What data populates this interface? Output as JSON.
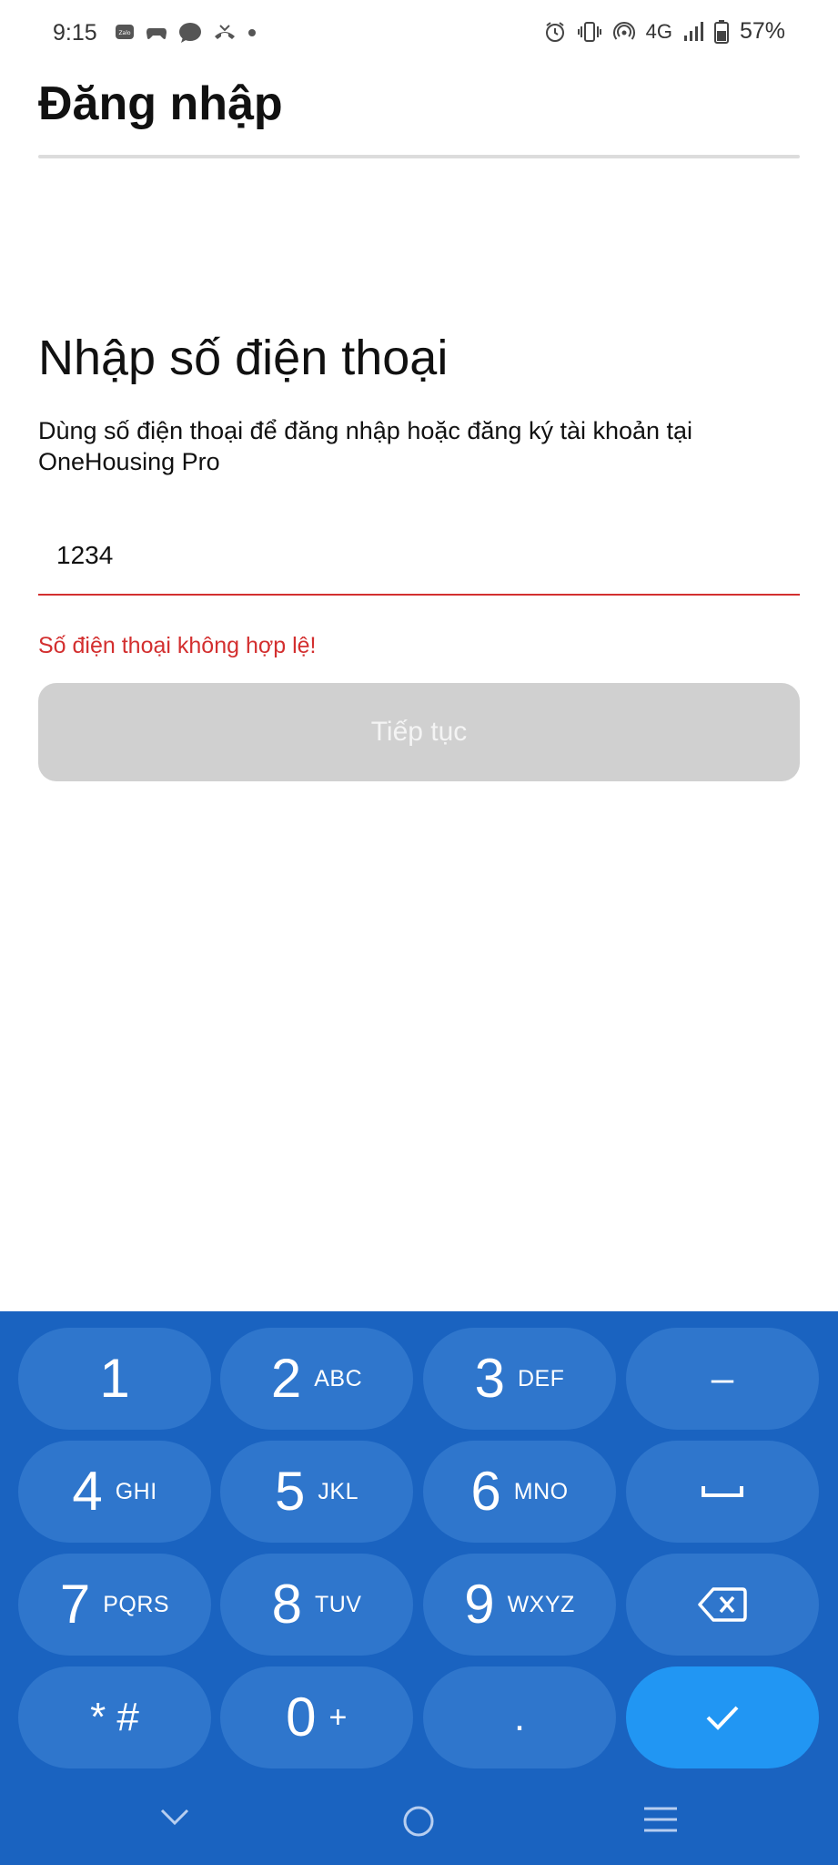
{
  "status_bar": {
    "time": "9:15",
    "left_icons": [
      "zalo-icon",
      "game-controller-icon",
      "message-bubble-icon",
      "missed-call-icon",
      "dot-icon"
    ],
    "right_icons": [
      "alarm-icon",
      "vibrate-icon",
      "hotspot-icon",
      "network-4g-icon",
      "signal-icon",
      "battery-icon"
    ],
    "network": "4G",
    "battery": "57%"
  },
  "header": {
    "title": "Đăng nhập"
  },
  "content": {
    "title": "Nhập số điện thoại",
    "description": "Dùng số điện thoại để đăng nhập hoặc đăng ký tài khoản tại OneHousing Pro",
    "phone_input": {
      "value": "1234"
    },
    "error": "Số điện thoại không hợp lệ!",
    "continue_button": "Tiếp tục"
  },
  "keyboard": {
    "keys": [
      {
        "digit": "1",
        "letters": ""
      },
      {
        "digit": "2",
        "letters": "ABC"
      },
      {
        "digit": "3",
        "letters": "DEF"
      },
      {
        "digit": "4",
        "letters": "GHI"
      },
      {
        "digit": "5",
        "letters": "JKL"
      },
      {
        "digit": "6",
        "letters": "MNO"
      },
      {
        "digit": "7",
        "letters": "PQRS"
      },
      {
        "digit": "8",
        "letters": "TUV"
      },
      {
        "digit": "9",
        "letters": "WXYZ"
      },
      {
        "digit": "* #",
        "letters": ""
      },
      {
        "digit": "0",
        "letters": "+"
      },
      {
        "digit": ".",
        "letters": ""
      }
    ],
    "dash": "–",
    "space_icon": "space-icon",
    "backspace_icon": "backspace-icon",
    "done_icon": "checkmark-icon"
  },
  "nav_bar": {
    "icons": [
      "chevron-down-icon",
      "home-circle-icon",
      "menu-icon"
    ]
  },
  "colors": {
    "error": "#d32f2f",
    "keyboard_bg": "#1a63c0",
    "key_bg": "#2f76cc",
    "done_key": "#2196f3",
    "button_disabled": "#d0d0d0"
  }
}
